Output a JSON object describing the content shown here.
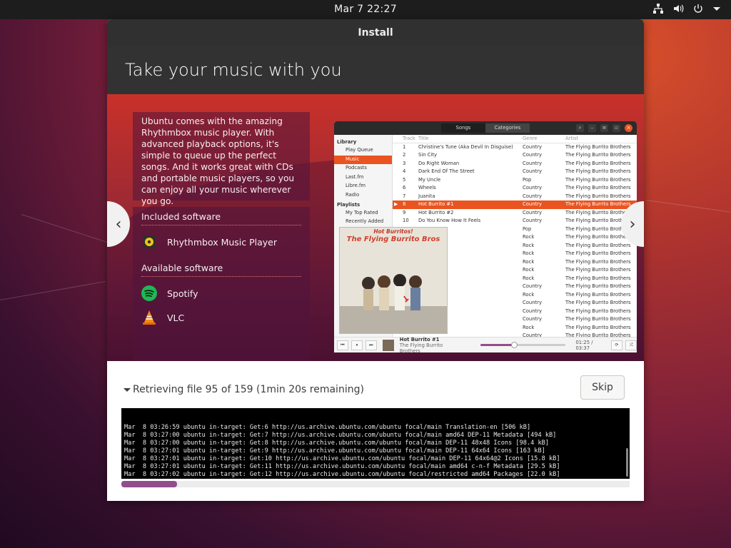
{
  "topbar": {
    "clock": "Mar 7  22:27",
    "icons": [
      "network-icon",
      "volume-icon",
      "power-icon",
      "menu-arrow-icon"
    ]
  },
  "window": {
    "title": "Install",
    "heading": "Take your music with you"
  },
  "slide": {
    "description": "Ubuntu comes with the amazing Rhythmbox music player. With advanced playback options, it's simple to queue up the perfect songs. And it works great with CDs and portable music players, so you can enjoy all your music wherever you go.",
    "included_label": "Included software",
    "included": [
      {
        "name": "Rhythmbox Music Player",
        "icon": "rhythmbox-icon"
      }
    ],
    "available_label": "Available software",
    "available": [
      {
        "name": "Spotify",
        "icon": "spotify-icon"
      },
      {
        "name": "VLC",
        "icon": "vlc-icon"
      }
    ],
    "prev": "‹",
    "next": "›"
  },
  "rhythmbox": {
    "tabs": [
      "Songs",
      "Categories"
    ],
    "library_label": "Library",
    "library": [
      "Play Queue",
      "Music",
      "Podcasts",
      "Last.fm",
      "Libre.fm",
      "Radio"
    ],
    "playlists_label": "Playlists",
    "playlists": [
      "My Top Rated",
      "Recently Added"
    ],
    "columns": [
      "Track",
      "Title",
      "Genre",
      "Artist"
    ],
    "rows": [
      {
        "track": "1",
        "title": "Christine's Tune (Aka Devil In Disguise)",
        "genre": "Country",
        "artist": "The Flying Burrito Brothers"
      },
      {
        "track": "2",
        "title": "Sin City",
        "genre": "Country",
        "artist": "The Flying Burrito Brothers"
      },
      {
        "track": "3",
        "title": "Do Right Woman",
        "genre": "Country",
        "artist": "The Flying Burrito Brothers"
      },
      {
        "track": "4",
        "title": "Dark End Of The Street",
        "genre": "Country",
        "artist": "The Flying Burrito Brothers"
      },
      {
        "track": "5",
        "title": "My Uncle",
        "genre": "Pop",
        "artist": "The Flying Burrito Brothers"
      },
      {
        "track": "6",
        "title": "Wheels",
        "genre": "Country",
        "artist": "The Flying Burrito Brothers"
      },
      {
        "track": "7",
        "title": "Juanita",
        "genre": "Country",
        "artist": "The Flying Burrito Brothers"
      },
      {
        "track": "8",
        "title": "Hot Burrito #1",
        "genre": "Country",
        "artist": "The Flying Burrito Brothers",
        "selected": true
      },
      {
        "track": "9",
        "title": "Hot Burrito #2",
        "genre": "Country",
        "artist": "The Flying Burrito Brothers"
      },
      {
        "track": "10",
        "title": "Do You Know How It Feels",
        "genre": "Country",
        "artist": "The Flying Burrito Brothers"
      },
      {
        "track": "",
        "title": "",
        "genre": "Pop",
        "artist": "The Flying Burrito Brothers"
      },
      {
        "track": "",
        "title": "ng",
        "genre": "Rock",
        "artist": "The Flying Burrito Brothers"
      },
      {
        "track": "",
        "title": "",
        "genre": "Rock",
        "artist": "The Flying Burrito Brothers"
      },
      {
        "track": "",
        "title": "e",
        "genre": "Rock",
        "artist": "The Flying Burrito Brothers"
      },
      {
        "track": "",
        "title": "n Queen",
        "genre": "Rock",
        "artist": "The Flying Burrito Brothers"
      },
      {
        "track": "",
        "title": "n Go",
        "genre": "Rock",
        "artist": "The Flying Burrito Brothers"
      },
      {
        "track": "",
        "title": "Fog",
        "genre": "Rock",
        "artist": "The Flying Burrito Brothers"
      },
      {
        "track": "",
        "title": "",
        "genre": "Country",
        "artist": "The Flying Burrito Brothers"
      },
      {
        "track": "",
        "title": "",
        "genre": "Rock",
        "artist": "The Flying Burrito Brothers"
      },
      {
        "track": "",
        "title": "",
        "genre": "Country",
        "artist": "The Flying Burrito Brothers"
      },
      {
        "track": "",
        "title": "Singer",
        "genre": "Country",
        "artist": "The Flying Burrito Brothers"
      },
      {
        "track": "",
        "title": "Churchyard",
        "genre": "Country",
        "artist": "The Flying Burrito Brothers"
      },
      {
        "track": "",
        "title": "",
        "genre": "Rock",
        "artist": "The Flying Burrito Brothers"
      },
      {
        "track": "",
        "title": "",
        "genre": "Country",
        "artist": "The Flying Burrito Brothers"
      }
    ],
    "album_title": "Hot Burritos!",
    "album_band": "The Flying Burrito Bros",
    "now_playing_title": "Hot Burrito #1",
    "now_playing_artist": "The Flying Burrito Brothers",
    "time": "01:25 / 03:37",
    "position_fraction": 0.39
  },
  "progress": {
    "status": "Retrieving file 95 of 159 (1min 20s remaining)",
    "skip_label": "Skip",
    "log": [
      "Mar  8 03:26:59 ubuntu in-target: Get:6 http://us.archive.ubuntu.com/ubuntu focal/main Translation-en [506 kB]",
      "Mar  8 03:27:00 ubuntu in-target: Get:7 http://us.archive.ubuntu.com/ubuntu focal/main amd64 DEP-11 Metadata [494 kB]",
      "Mar  8 03:27:00 ubuntu in-target: Get:8 http://us.archive.ubuntu.com/ubuntu focal/main DEP-11 48x48 Icons [98.4 kB]",
      "Mar  8 03:27:01 ubuntu in-target: Get:9 http://us.archive.ubuntu.com/ubuntu focal/main DEP-11 64x64 Icons [163 kB]",
      "Mar  8 03:27:01 ubuntu in-target: Get:10 http://us.archive.ubuntu.com/ubuntu focal/main DEP-11 64x64@2 Icons [15.8 kB]",
      "Mar  8 03:27:01 ubuntu in-target: Get:11 http://us.archive.ubuntu.com/ubuntu focal/main amd64 c-n-f Metadata [29.5 kB]",
      "Mar  8 03:27:02 ubuntu in-target: Get:12 http://us.archive.ubuntu.com/ubuntu focal/restricted amd64 Packages [22.0 kB]"
    ],
    "scroll_fraction": 0.11
  },
  "colors": {
    "accent": "#e95420",
    "scroll_thumb": "#924d8b"
  }
}
